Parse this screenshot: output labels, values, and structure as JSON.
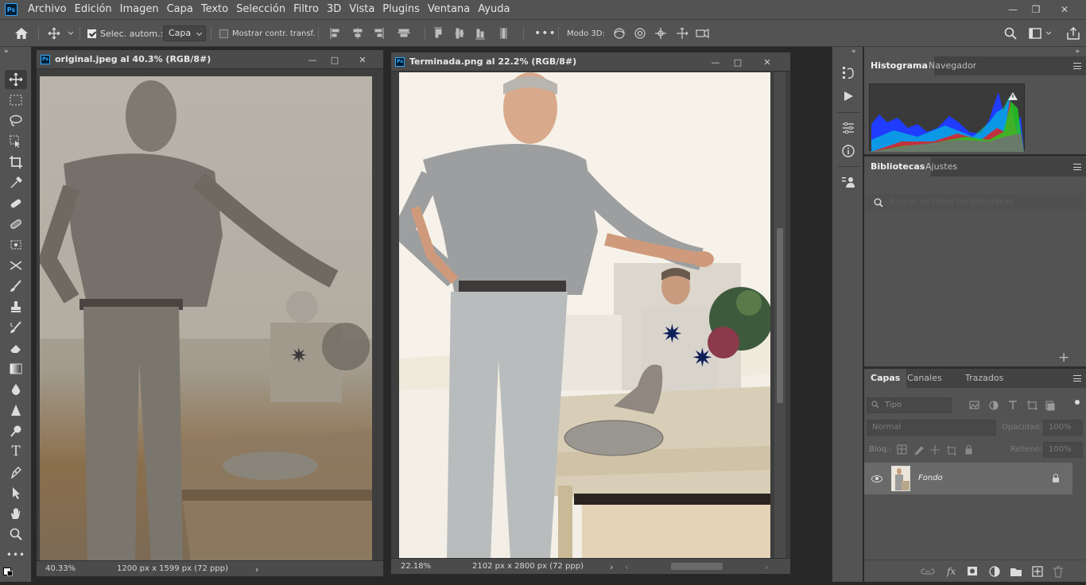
{
  "app": {
    "logo": "Ps"
  },
  "menu": [
    "Archivo",
    "Edición",
    "Imagen",
    "Capa",
    "Texto",
    "Selección",
    "Filtro",
    "3D",
    "Vista",
    "Plugins",
    "Ventana",
    "Ayuda"
  ],
  "options": {
    "auto_select_label": "Selec. autom.:",
    "auto_select_value": "Capa",
    "show_transform_label": "Mostrar contr. transf.",
    "mode3d_label": "Modo 3D:",
    "more": "•••"
  },
  "doc1": {
    "title": "original.jpeg al 40.3% (RGB/8#)",
    "zoom": "40.33%",
    "info": "1200 px x 1599 px (72 ppp)"
  },
  "doc2": {
    "title": "Terminada.png al 22.2% (RGB/8#)",
    "zoom": "22.18%",
    "info": "2102 px x 2800 px (72 ppp)"
  },
  "panels": {
    "histogram_tab": "Histograma",
    "navigator_tab": "Navegador",
    "libraries_tab": "Bibliotecas",
    "adjustments_tab": "Ajustes",
    "libraries_search_placeholder": "Buscar en todas las bibliotecas",
    "layers_tab": "Capas",
    "channels_tab": "Canales",
    "paths_tab": "Trazados",
    "filter_kind": "Tipo",
    "blend_mode": "Normal",
    "opacity_label": "Opacidad:",
    "opacity_value": "100%",
    "lock_label": "Bloq.:",
    "fill_label": "Relleno:",
    "fill_value": "100%",
    "layer_name": "Fondo"
  },
  "colors": {
    "ui_dark": "#282828",
    "panel": "#535353",
    "accent_ps": "#31a8ff"
  }
}
